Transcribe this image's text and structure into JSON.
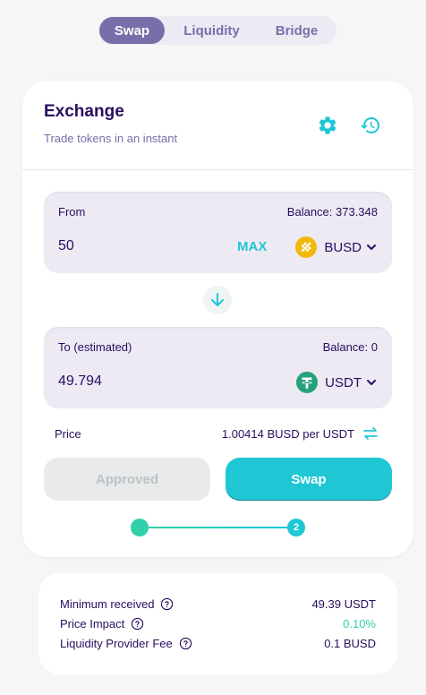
{
  "tabs": [
    {
      "label": "Swap",
      "active": true
    },
    {
      "label": "Liquidity",
      "active": false
    },
    {
      "label": "Bridge",
      "active": false
    }
  ],
  "header": {
    "title": "Exchange",
    "subtitle": "Trade tokens in an instant",
    "settings_icon": "gear-icon",
    "history_icon": "history-icon"
  },
  "from": {
    "label": "From",
    "balance": "Balance: 373.348",
    "amount": "50",
    "max_label": "MAX",
    "token": "BUSD",
    "token_icon": "busd-logo-icon"
  },
  "to": {
    "label": "To (estimated)",
    "balance": "Balance: 0",
    "amount": "49.794",
    "token": "USDT",
    "token_icon": "usdt-logo-icon"
  },
  "price": {
    "label": "Price",
    "value": "1.00414 BUSD per USDT"
  },
  "buttons": {
    "approved": "Approved",
    "swap": "Swap"
  },
  "stepper": {
    "current_step": "2"
  },
  "details": [
    {
      "label": "Minimum received",
      "value": "49.39 USDT"
    },
    {
      "label": "Price Impact",
      "value": "0.10%"
    },
    {
      "label": "Liquidity Provider Fee",
      "value": "0.1 BUSD"
    }
  ],
  "colors": {
    "primary": "#1fc7d4",
    "secondary": "#7a6eaa",
    "text": "#280d5f",
    "success": "#31d0aa",
    "input_bg": "#eeeaf4",
    "busd": "#f0b90b",
    "usdt": "#26a17b"
  }
}
